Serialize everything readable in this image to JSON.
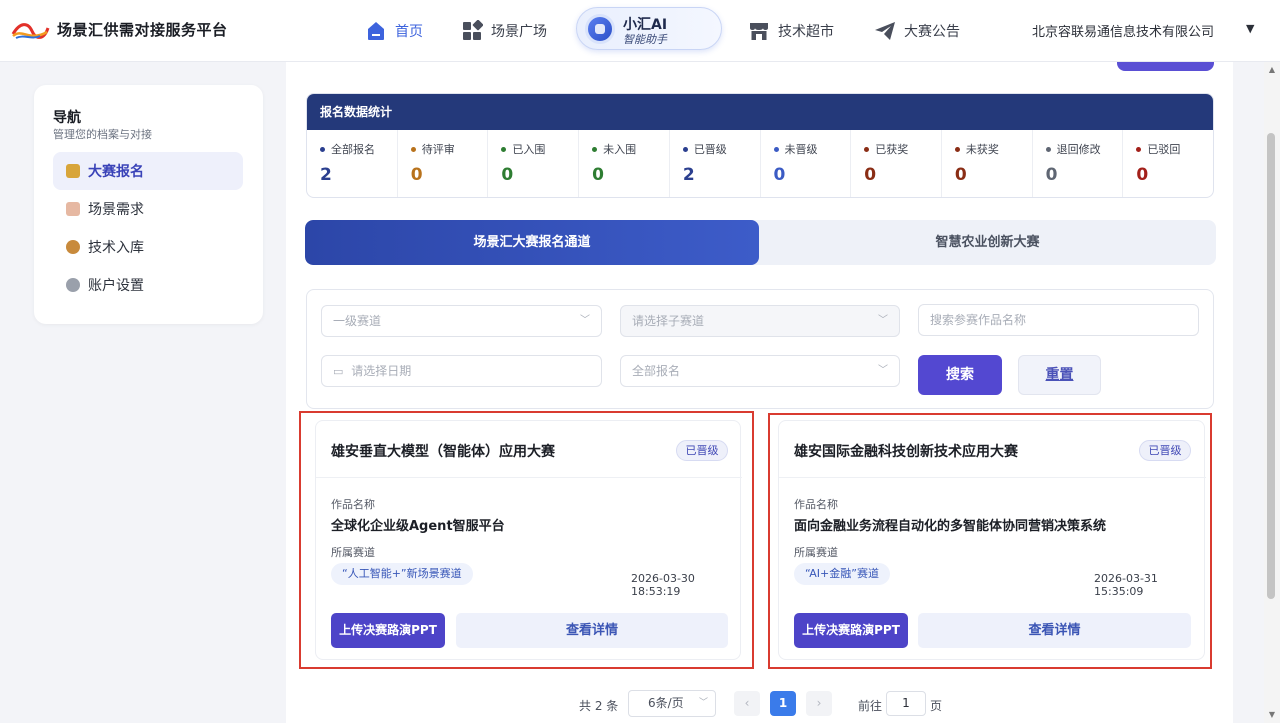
{
  "header": {
    "brand": "场景汇供需对接服务平台",
    "nav": [
      {
        "label": "首页",
        "icon": "home-icon"
      },
      {
        "label": "场景广场",
        "icon": "grid-icon"
      },
      {
        "label": "技术超市",
        "icon": "store-icon"
      },
      {
        "label": "大赛公告",
        "icon": "paper-plane-icon"
      }
    ],
    "ai_title": "小汇AI",
    "ai_subtitle": "智能助手",
    "company": "北京容联易通信息技术有限公司",
    "caret": "▼"
  },
  "sidebar": {
    "title": "导航",
    "subtitle": "管理您的档案与对接",
    "items": [
      {
        "label": "大赛报名",
        "icon": "trophy-icon",
        "active": true
      },
      {
        "label": "场景需求",
        "icon": "document-icon",
        "active": false
      },
      {
        "label": "技术入库",
        "icon": "medal-icon",
        "active": false
      },
      {
        "label": "账户设置",
        "icon": "gear-icon",
        "active": false
      }
    ]
  },
  "stats": {
    "title": "报名数据统计",
    "items": [
      {
        "label": "全部报名",
        "value": "2",
        "color": "#2b3f8f"
      },
      {
        "label": "待评审",
        "value": "0",
        "color": "#b8721c"
      },
      {
        "label": "已入围",
        "value": "0",
        "color": "#2e7d32"
      },
      {
        "label": "未入围",
        "value": "0",
        "color": "#2e7d32"
      },
      {
        "label": "已晋级",
        "value": "2",
        "color": "#2b3f8f"
      },
      {
        "label": "未晋级",
        "value": "0",
        "color": "#3b5bc4"
      },
      {
        "label": "已获奖",
        "value": "0",
        "color": "#8a2d15"
      },
      {
        "label": "未获奖",
        "value": "0",
        "color": "#8a2d15"
      },
      {
        "label": "退回修改",
        "value": "0",
        "color": "#5f6673"
      },
      {
        "label": "已驳回",
        "value": "0",
        "color": "#a3201a"
      }
    ]
  },
  "tabs": [
    "场景汇大赛报名通道",
    "智慧农业创新大赛"
  ],
  "filters": {
    "track_placeholder": "一级赛道",
    "subtrack_placeholder": "请选择子赛道",
    "work_name_placeholder": "搜索参赛作品名称",
    "date_placeholder": "请选择日期",
    "status_value": "全部报名",
    "search_label": "搜索",
    "reset_label": "重置"
  },
  "cards": [
    {
      "title": "雄安垂直大模型（智能体）应用大赛",
      "badge": "已晋级",
      "work_label": "作品名称",
      "work_name": "全球化企业级Agent智服平台",
      "track_label": "所属赛道",
      "track": "“人工智能+”新场景赛道",
      "time": "2026-03-30 18:53:19",
      "upload_label": "上传决赛路演PPT",
      "detail_label": "查看详情"
    },
    {
      "title": "雄安国际金融科技创新技术应用大赛",
      "badge": "已晋级",
      "work_label": "作品名称",
      "work_name": "面向金融业务流程自动化的多智能体协同营销决策系统",
      "track_label": "所属赛道",
      "track": "“AI+金融”赛道",
      "time": "2026-03-31 15:35:09",
      "upload_label": "上传决赛路演PPT",
      "detail_label": "查看详情"
    }
  ],
  "pagination": {
    "total": "共 2 条",
    "page_size": "6条/页",
    "prev": "‹",
    "current": "1",
    "next": "›",
    "goto_label": "前往",
    "goto_value": "1",
    "goto_unit": "页"
  },
  "colors": {
    "accent": "#5348d1",
    "primary_blue": "#3d63dd",
    "stats_header": "#24397a",
    "highlight_red": "#d93b30"
  }
}
